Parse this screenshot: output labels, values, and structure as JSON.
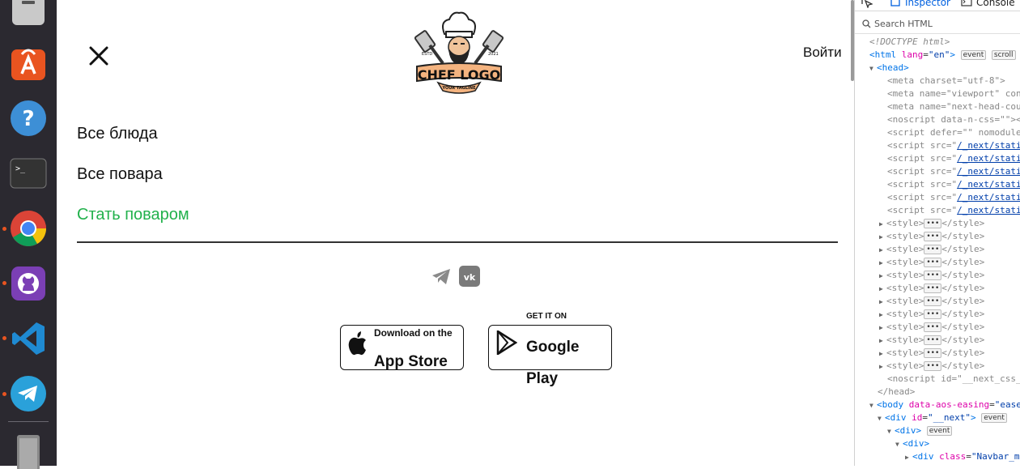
{
  "dock": {
    "items": [
      {
        "name": "files-app-icon"
      },
      {
        "name": "ubuntu-software-icon"
      },
      {
        "name": "help-icon"
      },
      {
        "name": "terminal-icon"
      },
      {
        "name": "chrome-icon"
      },
      {
        "name": "github-desktop-icon"
      },
      {
        "name": "vscode-icon"
      },
      {
        "name": "telegram-icon"
      },
      {
        "name": "trash-icon"
      }
    ],
    "accent": "#e95420"
  },
  "page": {
    "logo": {
      "title": "CHEF LOGO",
      "tagline": "YOUR TAGLINE",
      "estd": "ESTD",
      "year": "2021"
    },
    "login_label": "Войти",
    "menu": [
      {
        "label": "Все блюда"
      },
      {
        "label": "Все повара"
      },
      {
        "label": "Стать поваром"
      }
    ],
    "highlight_color": "#22b14c",
    "social": [
      "telegram-icon",
      "vk-icon"
    ],
    "stores": {
      "apple": {
        "small": "Download on the",
        "big": "App Store"
      },
      "google": {
        "small": "GET IT ON",
        "big_1": "Google",
        "big_2": "Play"
      }
    }
  },
  "devtools": {
    "tabs": {
      "inspector": "Inspector",
      "console": "Console"
    },
    "search_placeholder": "Search HTML",
    "lines": {
      "doctype": "<!DOCTYPE html>",
      "html_open": "<html",
      "html_attr": "lang",
      "html_val": "\"en\"",
      "event": "event",
      "scroll": "scroll",
      "head": "<head>",
      "meta_charset": "charset",
      "meta_charset_val": "\"utf-8\"",
      "meta_viewport_name": "\"viewport\"",
      "meta_viewport_rest": "con",
      "meta_next_head": "next-head-cou",
      "noscript_attr": "data-n-css",
      "noscript_val": "\"\"",
      "script_defer": "defer",
      "script_nomodule": "nomodule",
      "script_src_val": "/_next/stati",
      "style_ellipsis": "•••",
      "noscript_id": "\"__next_css_",
      "head_close": "</head>",
      "body_attr": "data-aos-easing",
      "body_val": "\"ease",
      "div_id": "\"__next\"",
      "div_class": "\"Navbar_m"
    }
  }
}
